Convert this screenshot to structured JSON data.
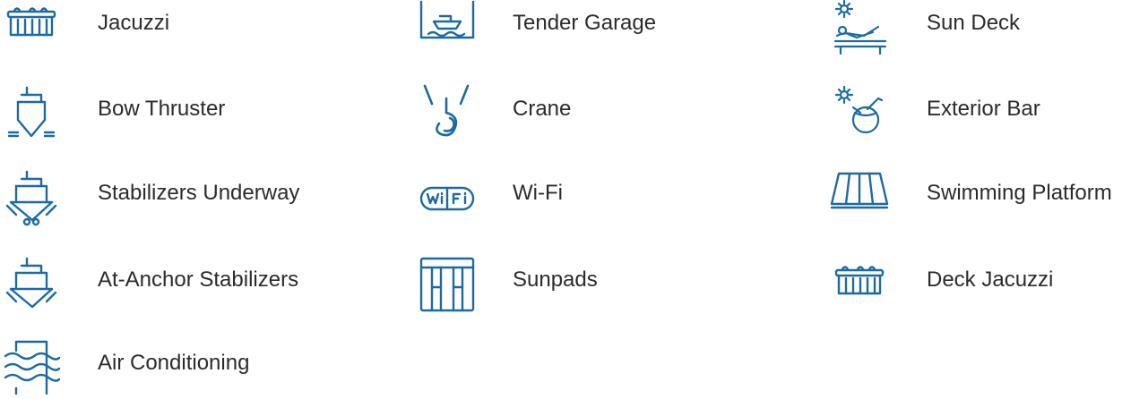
{
  "icon_color": "#1d6aa1",
  "text_color": "#2b2b2b",
  "amenities": [
    {
      "label": "Jacuzzi",
      "icon": "jacuzzi-icon"
    },
    {
      "label": "Tender Garage",
      "icon": "tender-garage-icon"
    },
    {
      "label": "Sun Deck",
      "icon": "sun-deck-icon"
    },
    {
      "label": "Bow Thruster",
      "icon": "bow-thruster-icon"
    },
    {
      "label": "Crane",
      "icon": "crane-icon"
    },
    {
      "label": "Exterior Bar",
      "icon": "exterior-bar-icon"
    },
    {
      "label": "Stabilizers Underway",
      "icon": "stabilizers-underway-icon"
    },
    {
      "label": "Wi-Fi",
      "icon": "wifi-icon"
    },
    {
      "label": "Swimming Platform",
      "icon": "swimming-platform-icon"
    },
    {
      "label": "At-Anchor Stabilizers",
      "icon": "at-anchor-stabilizers-icon"
    },
    {
      "label": "Sunpads",
      "icon": "sunpads-icon"
    },
    {
      "label": "Deck Jacuzzi",
      "icon": "deck-jacuzzi-icon"
    },
    {
      "label": "Air Conditioning",
      "icon": "air-conditioning-icon"
    }
  ]
}
